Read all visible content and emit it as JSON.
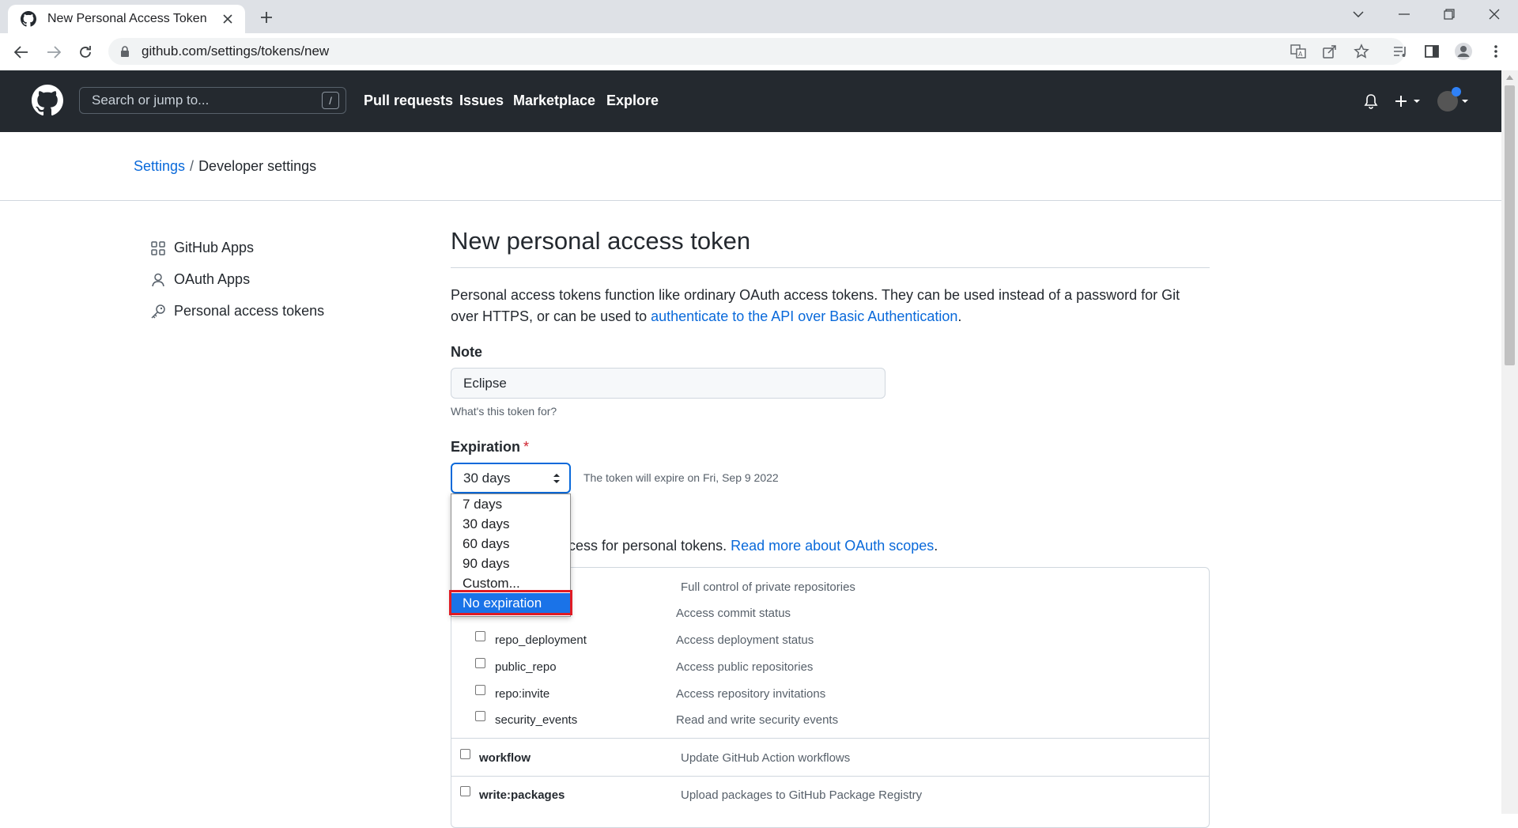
{
  "browser": {
    "tab_title": "New Personal Access Token",
    "url": "github.com/settings/tokens/new"
  },
  "header": {
    "search_placeholder": "Search or jump to...",
    "search_shortcut": "/",
    "nav": [
      "Pull requests",
      "Issues",
      "Marketplace",
      "Explore"
    ]
  },
  "breadcrumb": {
    "parent": "Settings",
    "separator": "/",
    "current": "Developer settings"
  },
  "sidebar": {
    "items": [
      {
        "label": "GitHub Apps",
        "icon": "apps-icon"
      },
      {
        "label": "OAuth Apps",
        "icon": "person-icon"
      },
      {
        "label": "Personal access tokens",
        "icon": "key-icon"
      }
    ]
  },
  "main": {
    "title": "New personal access token",
    "intro_text": "Personal access tokens function like ordinary OAuth access tokens. They can be used instead of a password for Git over HTTPS, or can be used to ",
    "intro_link": "authenticate to the API over Basic Authentication",
    "intro_end": ".",
    "note_label": "Note",
    "note_value": "Eclipse",
    "note_hint": "What's this token for?",
    "expiration_label": "Expiration",
    "expiration_required": "*",
    "expiration_value": "30 days",
    "expiration_note": "The token will expire on Fri, Sep 9 2022",
    "scopes_text": "ccess for personal tokens. ",
    "scopes_link": "Read more about OAuth scopes",
    "scopes_end": "."
  },
  "dropdown": {
    "options": [
      "7 days",
      "30 days",
      "60 days",
      "90 days",
      "Custom...",
      "No expiration"
    ],
    "highlighted": "No expiration"
  },
  "scopes": [
    {
      "name": "",
      "desc": "Full control of private repositories",
      "level": "top"
    },
    {
      "name": "",
      "desc": "Access commit status",
      "level": "sub"
    },
    {
      "name": "repo_deployment",
      "desc": "Access deployment status",
      "level": "sub"
    },
    {
      "name": "public_repo",
      "desc": "Access public repositories",
      "level": "sub"
    },
    {
      "name": "repo:invite",
      "desc": "Access repository invitations",
      "level": "sub"
    },
    {
      "name": "security_events",
      "desc": "Read and write security events",
      "level": "sub"
    },
    {
      "name": "workflow",
      "desc": "Update GitHub Action workflows",
      "level": "top"
    },
    {
      "name": "write:packages",
      "desc": "Upload packages to GitHub Package Registry",
      "level": "top"
    }
  ],
  "colors": {
    "header_bg": "#24292f",
    "link": "#0969da",
    "dropdown_selected": "#1a73e8",
    "highlight_border": "#e01b24"
  }
}
